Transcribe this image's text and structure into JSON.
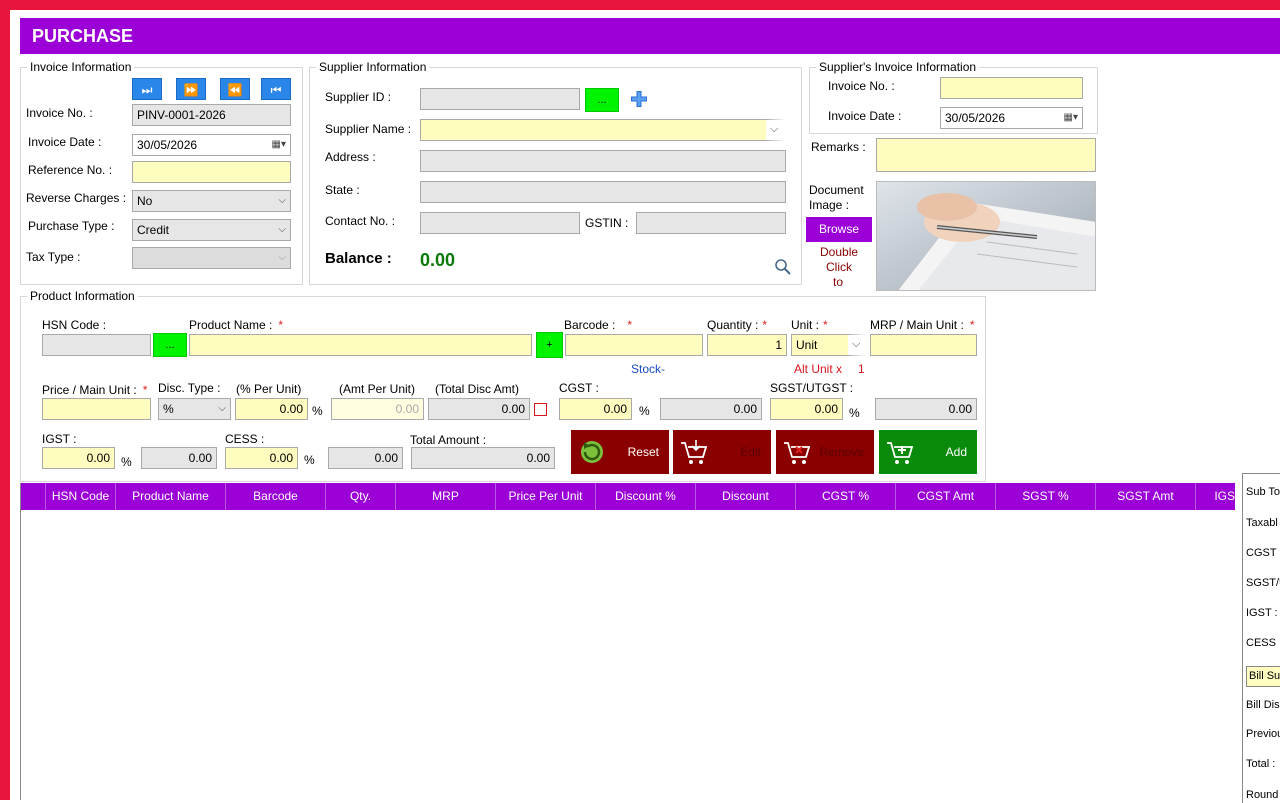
{
  "title": "PURCHASE",
  "invoice": {
    "legend": "Invoice Information",
    "nav": {
      "next": "⏭",
      "forward": "⏩",
      "back": "⏪",
      "first": "⏮"
    },
    "invoice_no_label": "Invoice No. :",
    "invoice_no_value": "PINV-0001-2026",
    "invoice_date_label": "Invoice Date :",
    "invoice_date_value": "30/05/2026",
    "reference_label": "Reference No. :",
    "reference_value": "",
    "reverse_label": "Reverse Charges :",
    "reverse_value": "No",
    "purchase_type_label": "Purchase Type :",
    "purchase_type_value": "Credit",
    "tax_type_label": "Tax Type :",
    "tax_type_value": ""
  },
  "supplier": {
    "legend": "Supplier Information",
    "id_label": "Supplier ID :",
    "id_value": "",
    "lookup_label": "...",
    "name_label": "Supplier Name :",
    "name_value": "",
    "address_label": "Address :",
    "address_value": "",
    "state_label": "State :",
    "state_value": "",
    "contact_label": "Contact No. :",
    "contact_value": "",
    "gstin_label": "GSTIN :",
    "gstin_value": "",
    "balance_label": "Balance :",
    "balance_value": "0.00"
  },
  "supplier_invoice": {
    "legend": "Supplier's Invoice Information",
    "invoice_no_label": "Invoice No. :",
    "invoice_no_value": "",
    "invoice_date_label": "Invoice Date :",
    "invoice_date_value": "30/05/2026",
    "remarks_label": "Remarks :",
    "remarks_value": "",
    "doc_label_1": "Document",
    "doc_label_2": "Image :",
    "browse_label": "Browse",
    "dbl_1": "Double",
    "dbl_2": "Click",
    "dbl_3": "to"
  },
  "product": {
    "legend": "Product Information",
    "hsn_label": "HSN Code :",
    "hsn_value": "",
    "hsn_lookup": "...",
    "name_label": "Product Name :",
    "name_value": "",
    "add_product": "+",
    "barcode_label": "Barcode :",
    "barcode_value": "",
    "qty_label": "Quantity :",
    "qty_value": "1",
    "unit_label": "Unit :",
    "unit_value": "Unit",
    "mrp_label": "MRP / Main Unit :",
    "mrp_value": "",
    "required_mark": "*",
    "stock_label": "Stock-",
    "alt_unit_label": "Alt Unit x",
    "alt_unit_value": "1",
    "price_label": "Price / Main Unit :",
    "price_value": "",
    "disc_type_label": "Disc. Type :",
    "disc_type_value": "%",
    "pct_per_unit_label": "(%  Per Unit)",
    "pct_per_unit_value": "0.00",
    "amt_per_unit_label": "(Amt Per Unit)",
    "amt_per_unit_value": "0.00",
    "total_disc_label": "(Total Disc Amt)",
    "total_disc_value": "0.00",
    "cgst_label": "CGST :",
    "cgst_pct": "0.00",
    "cgst_amt": "0.00",
    "sgst_label": "SGST/UTGST :",
    "sgst_pct": "0.00",
    "sgst_amt": "0.00",
    "igst_label": "IGST :",
    "igst_pct": "0.00",
    "igst_amt": "0.00",
    "cess_label": "CESS :",
    "cess_pct": "0.00",
    "cess_amt": "0.00",
    "total_label": "Total Amount :",
    "total_value": "0.00",
    "pct_symbol": "%"
  },
  "actions": {
    "reset": "Reset",
    "edit": "Edit",
    "remove": "Remove",
    "add": "Add"
  },
  "table": {
    "columns": [
      "HSN Code",
      "Product Name",
      "Barcode",
      "Qty.",
      "MRP",
      "Price Per Unit",
      "Discount %",
      "Discount",
      "CGST %",
      "CGST Amt",
      "SGST %",
      "SGST Amt",
      "IGS"
    ]
  },
  "summary": {
    "sub_total": "Sub To",
    "taxable": "Taxabl",
    "cgst": "CGST :",
    "sgst": "SGST/U",
    "igst": "IGST :",
    "cess": "CESS :",
    "bill_sundry": "Bill Su",
    "bill_disc": "Bill Dis",
    "previous": "Previou",
    "total": "Total :",
    "round": "Round"
  },
  "colors": {
    "accent": "#9b00d6",
    "frame": "#e8163f",
    "input_yellow": "#fffcc0",
    "balance": "#0b7a0b",
    "reset_btn": "#8a0000",
    "add_btn": "#0a8a0a"
  }
}
